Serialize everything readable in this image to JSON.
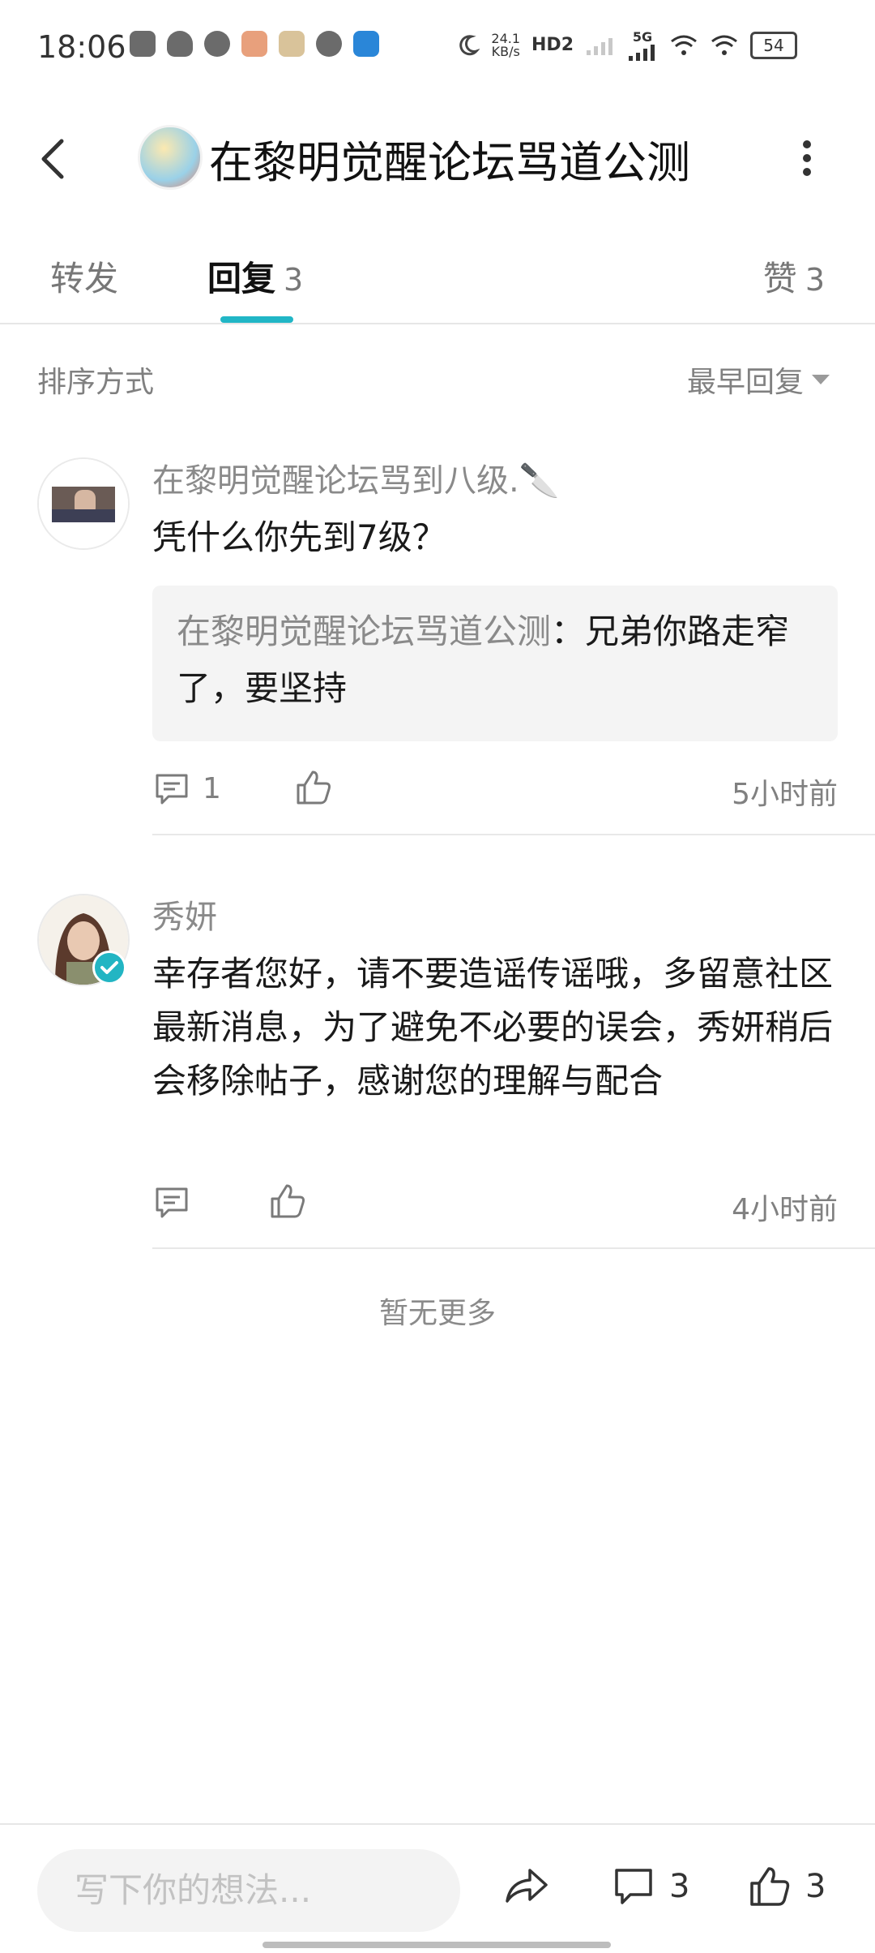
{
  "status_bar": {
    "time": "18:06",
    "net_speed_value": "24.1",
    "net_speed_unit": "KB/s",
    "hd_label": "HD2",
    "network": "5G",
    "battery": "54",
    "app_icons": [
      "app-icon",
      "qq-icon",
      "wechat-icon",
      "game-icon",
      "game-icon",
      "weibo-icon",
      "app-icon"
    ]
  },
  "header": {
    "title": "在黎明觉醒论坛骂道公测"
  },
  "tabs": [
    {
      "label": "转发",
      "count": ""
    },
    {
      "label": "回复",
      "count": "3"
    },
    {
      "label": "赞",
      "count": "3"
    }
  ],
  "sort": {
    "label": "排序方式",
    "value": "最早回复"
  },
  "comments": [
    {
      "author": "在黎明觉醒论坛骂到八级.🔪",
      "text": "凭什么你先到7级？",
      "quote_author": "在黎明觉醒论坛骂道公测",
      "quote_text": "：兄弟你路走窄了，要坚持",
      "reply_count": "1",
      "time": "5小时前"
    },
    {
      "author": "秀妍",
      "text": "幸存者您好，请不要造谣传谣哦，多留意社区最新消息，为了避免不必要的误会，秀妍稍后会移除帖子，感谢您的理解与配合",
      "time": "4小时前"
    }
  ],
  "no_more": "暂无更多",
  "bottom_bar": {
    "input_placeholder": "写下你的想法...",
    "comment_count": "3",
    "like_count": "3"
  },
  "colors": {
    "accent": "#21b6c6",
    "text_primary": "#1a1a1a",
    "text_secondary": "#808080"
  }
}
